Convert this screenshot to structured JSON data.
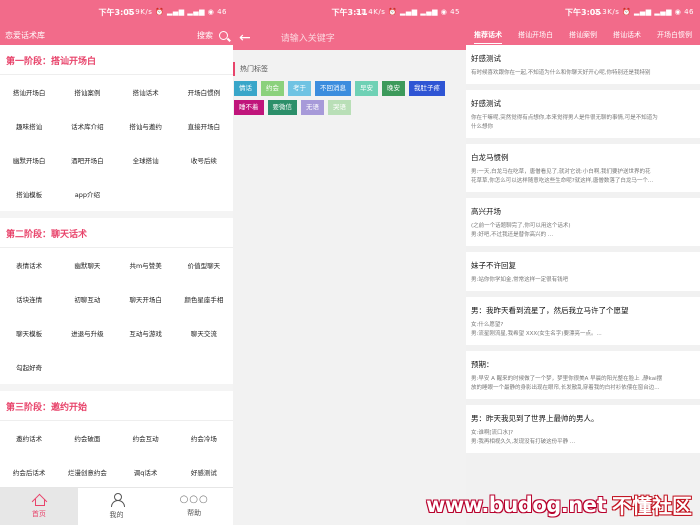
{
  "colors": {
    "accent": "#f26b8a",
    "stage_title": "#e8446b"
  },
  "phone1": {
    "status": {
      "time": "下午3:05",
      "right": "1.9K/s ⏰ ▂▄▆ ▂▄▆ ◉ 46"
    },
    "header": {
      "title": "恋爱话术库",
      "search_label": "搜索",
      "search_icon": "search-icon"
    },
    "stages": [
      {
        "title": "第一阶段：搭讪开场白",
        "items": [
          "搭讪开场白",
          "搭讪案例",
          "搭讪话术",
          "开场白惯例",
          "趣味搭讪",
          "话术库介绍",
          "搭讪与邀约",
          "直接开场白",
          "幽默开场白",
          "酒吧开场白",
          "全球搭讪",
          "收号后续",
          "搭讪模板",
          "app介绍"
        ]
      },
      {
        "title": "第二阶段：聊天话术",
        "items": [
          "表情话术",
          "幽默聊天",
          "共m与赞美",
          "价值型聊天",
          "话块连情",
          "初聊互动",
          "聊天开场白",
          "颜色星座手相",
          "聊天模板",
          "进退与升级",
          "互动与游戏",
          "聊天交流",
          "勾起好奇"
        ]
      },
      {
        "title": "第三阶段：邀约开始",
        "items": [
          "邀约话术",
          "约会破面",
          "约会互动",
          "约会冷场",
          "约会后话术",
          "烂漫创意约会",
          "调q话术",
          "好感测试"
        ]
      }
    ],
    "tabbar": [
      {
        "label": "首页",
        "icon": "home-icon"
      },
      {
        "label": "我的",
        "icon": "user-icon"
      },
      {
        "label": "帮助",
        "icon": "more-dots-icon"
      }
    ]
  },
  "phone2": {
    "status": {
      "time": "下午3:11",
      "right": "31.4K/s ⏰ ▂▄▆ ▂▄▆ ◉ 45"
    },
    "search": {
      "placeholder": "请输入关键字",
      "back_icon": "back-arrow-icon"
    },
    "hot_title": "热门标签",
    "tags": [
      {
        "label": "情话",
        "color": "#39a6c9"
      },
      {
        "label": "约会",
        "color": "#8bd17c"
      },
      {
        "label": "考于",
        "color": "#6fc3e3"
      },
      {
        "label": "不回消息",
        "color": "#3c8dde"
      },
      {
        "label": "早安",
        "color": "#6fd1b5"
      },
      {
        "label": "晚安",
        "color": "#3d9a5b"
      },
      {
        "label": "我肚子疼",
        "color": "#2f55d4"
      },
      {
        "label": "睡不着",
        "color": "#c0157b"
      },
      {
        "label": "要微信",
        "color": "#2c8f6a"
      },
      {
        "label": "无语",
        "color": "#a79ad9"
      },
      {
        "label": "哭语",
        "color": "#b9dfb7"
      }
    ]
  },
  "phone3": {
    "status": {
      "time": "下午3:05",
      "right": "2.3K/s ⏰ ▂▄▆ ▂▄▆ ◉ 46"
    },
    "tabs": [
      "推荐话术",
      "搭讪开场白",
      "搭讪案例",
      "搭讪话术",
      "开场白惯例"
    ],
    "cards": [
      {
        "title": "好感测试",
        "body": [
          "有时候喜欢跟你在一起,不知道为什么和你聊天好开心呢,你特别还是我特别"
        ]
      },
      {
        "title": "好感测试",
        "body": [
          "你在干嘛呢,突然觉得有点想你,本来觉得男人是件很无聊的事情,可是不知道为",
          "什么想你"
        ]
      },
      {
        "title": "白龙马惯例",
        "body": [
          "男:一天,白龙马在吃草，唐僧看见了,就对它说:小白啊,我们要护送世界的花",
          "花草草,你怎么可以这样随意吃这些生命呢?就这样,唐僧数落了白龙马一个..."
        ]
      },
      {
        "title": "高兴开场",
        "body": [
          "(之前一个话题聊完了,你可以用这个话术)",
          "男:好吧,不过我还是替你高兴的 ..."
        ]
      },
      {
        "title": "妹子不许回复",
        "body": [
          "男:站你你学如金,常常这样一定很有钱吧"
        ]
      },
      {
        "title": "男：我昨天看到流星了，然后我立马许了个愿望",
        "body": [
          "女:什么愿望?",
          "男:流星刚流星,我希望 XXX(女生名字)要漂亮一点。..."
        ]
      },
      {
        "title": "预期：",
        "body": [
          "男:早安 A 醒来的时候做了一个梦，梦里你很美A 早晨的阳光整在脸上 ,静kai摆",
          "放的睡眼一个最静的身影出现在眼帘,长发散乱穿着我的白衬衫依偎在窗台边..."
        ]
      },
      {
        "title": "男：昨天我见到了世界上最帅的男人。",
        "body": [
          "女:谁啊[流口水]?",
          "男:我再相视久久,发现没有打破这份平静 ..."
        ]
      }
    ]
  },
  "watermark": {
    "url": "www.budog.net",
    "logo": "不懂社区"
  }
}
